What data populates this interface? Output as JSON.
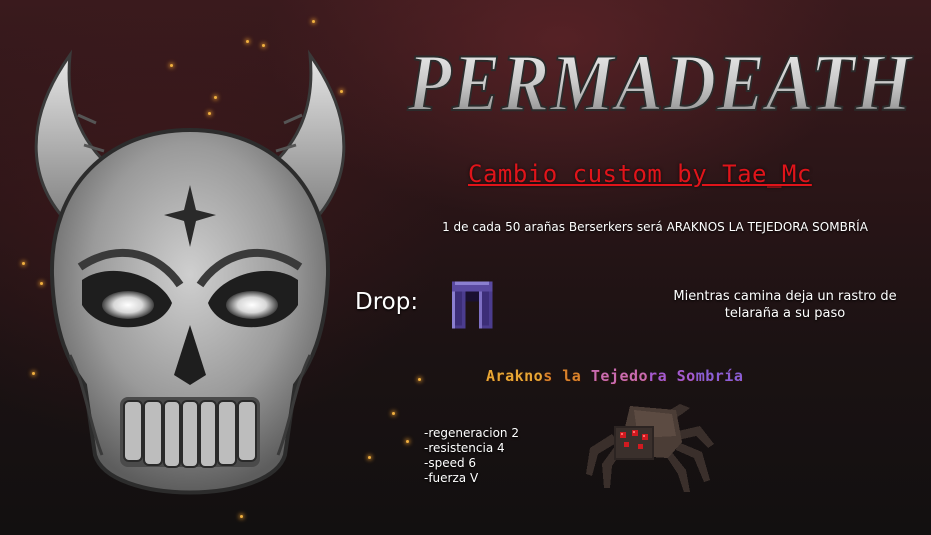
{
  "logo": {
    "text": "PERMADEATH",
    "colors": {
      "metal_light": "#ececec",
      "metal_dark": "#8a8a8a"
    }
  },
  "subtitle": {
    "text": "Cambio custom by Tae_Mc",
    "color": "#e0141a"
  },
  "info": {
    "description": "1 de cada 50 arañas Berserkers será ARAKNOS LA TEJEDORA SOMBRÍA"
  },
  "drop": {
    "label": "Drop:",
    "item_icon": "netherite-leggings-icon",
    "item_colors": {
      "frame": "#5a4aa0",
      "inner": "#3c2e78",
      "highlight": "#8b7fd0"
    }
  },
  "trail_note": {
    "text": "Mientras camina deja un rastro de telaraña a su paso"
  },
  "boss": {
    "name": "Araknos la Tejedora Sombría",
    "name_gradient": [
      "#e8a634",
      "#d9822b",
      "#c96bb0",
      "#a45bd1",
      "#8a5fd6"
    ],
    "icon": "spider-icon",
    "eye_color": "#d11a20"
  },
  "stats": {
    "items": [
      "-regeneracion 2",
      "-resistencia 4",
      "-speed 6",
      "-fuerza V"
    ]
  },
  "decor": {
    "skull_icon": "horned-skull-icon",
    "spark_color": "#f0b040"
  }
}
